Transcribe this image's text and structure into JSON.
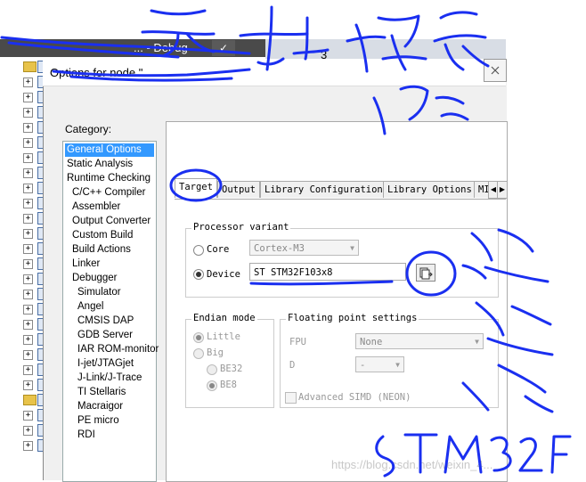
{
  "ide": {
    "title": "... - Debug",
    "check_glyph": "✓",
    "editor_tab_number": "3"
  },
  "dialog": {
    "title": "Options for node \"",
    "category_label": "Category:",
    "categories": [
      {
        "label": "General Options",
        "selected": true,
        "indent": false
      },
      {
        "label": "Static Analysis",
        "selected": false,
        "indent": false
      },
      {
        "label": "Runtime Checking",
        "selected": false,
        "indent": false
      },
      {
        "label": "C/C++ Compiler",
        "selected": false,
        "indent": true
      },
      {
        "label": "Assembler",
        "selected": false,
        "indent": true
      },
      {
        "label": "Output Converter",
        "selected": false,
        "indent": true
      },
      {
        "label": "Custom Build",
        "selected": false,
        "indent": true
      },
      {
        "label": "Build Actions",
        "selected": false,
        "indent": true
      },
      {
        "label": "Linker",
        "selected": false,
        "indent": true
      },
      {
        "label": "Debugger",
        "selected": false,
        "indent": true
      },
      {
        "label": "Simulator",
        "selected": false,
        "indent": "sub"
      },
      {
        "label": "Angel",
        "selected": false,
        "indent": "sub"
      },
      {
        "label": "CMSIS DAP",
        "selected": false,
        "indent": "sub"
      },
      {
        "label": "GDB Server",
        "selected": false,
        "indent": "sub"
      },
      {
        "label": "IAR ROM-monitor",
        "selected": false,
        "indent": "sub"
      },
      {
        "label": "I-jet/JTAGjet",
        "selected": false,
        "indent": "sub"
      },
      {
        "label": "J-Link/J-Trace",
        "selected": false,
        "indent": "sub"
      },
      {
        "label": "TI Stellaris",
        "selected": false,
        "indent": "sub"
      },
      {
        "label": "Macraigor",
        "selected": false,
        "indent": "sub"
      },
      {
        "label": "PE micro",
        "selected": false,
        "indent": "sub"
      },
      {
        "label": "RDI",
        "selected": false,
        "indent": "sub"
      }
    ],
    "tabs": [
      "Target",
      "Output",
      "Library Configuration",
      "Library Options",
      "MI"
    ],
    "active_tab": "Target",
    "processor_variant": {
      "legend": "Processor variant",
      "core_label": "Core",
      "core_value": "Cortex-M3",
      "device_label": "Device",
      "device_value": "ST STM32F103x8",
      "selected": "Device"
    },
    "endian": {
      "legend": "Endian mode",
      "little_label": "Little",
      "big_label": "Big",
      "be32_label": "BE32",
      "be8_label": "BE8"
    },
    "floating_point": {
      "legend": "Floating point settings",
      "fpu_label": "FPU",
      "fpu_value": "None",
      "d_label": "D",
      "d_value": "-",
      "simd_label": "Advanced SIMD (NEON)"
    }
  },
  "watermark": "https://blog.csdn.net/weixin_4...",
  "icons": {
    "close": "close-icon",
    "browse": "device-browse-icon",
    "expand": "expand-plus-icon",
    "folder": "folder-icon",
    "file": "file-icon"
  },
  "colors": {
    "selection": "#3399ff",
    "ink": "#1a2ff0"
  }
}
